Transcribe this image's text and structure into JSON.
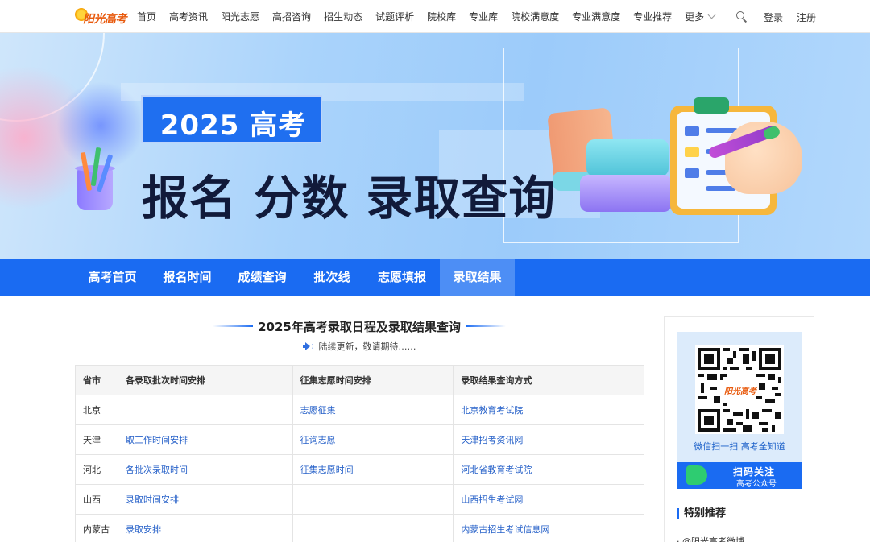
{
  "logo": {
    "text": "阳光高考"
  },
  "nav": {
    "items": [
      "首页",
      "高考资讯",
      "阳光志愿",
      "高招咨询",
      "招生动态",
      "试题评析",
      "院校库",
      "专业库",
      "院校满意度",
      "专业满意度",
      "专业推荐"
    ],
    "more": "更多",
    "login": "登录",
    "register": "注册"
  },
  "banner": {
    "year": "2025 高考",
    "headline": "报名 分数 录取查询"
  },
  "tabs": [
    "高考首页",
    "报名时间",
    "成绩查询",
    "批次线",
    "志愿填报",
    "录取结果"
  ],
  "main": {
    "title": "2025年高考录取日程及录取结果查询",
    "notice": "陆续更新，敬请期待……",
    "table": {
      "headers": [
        "省市",
        "各录取批次时间安排",
        "征集志愿时间安排",
        "录取结果查询方式"
      ],
      "rows": [
        [
          "北京",
          "",
          "志愿征集",
          "北京教育考试院"
        ],
        [
          "天津",
          "取工作时间安排",
          "征询志愿",
          "天津招考资讯网"
        ],
        [
          "河北",
          "各批次录取时间",
          "征集志愿时间",
          "河北省教育考试院"
        ],
        [
          "山西",
          "录取时间安排",
          "",
          "山西招生考试网"
        ],
        [
          "内蒙古",
          "录取安排",
          "",
          "内蒙古招生考试信息网"
        ]
      ]
    }
  },
  "sidebar": {
    "qr_caption": "微信扫一扫 高考全知道",
    "qr_logo": "阳光高考",
    "follow_line1": "扫码关注",
    "follow_line2": "高考公众号",
    "recommend_title": "特别推荐",
    "recommend_item": "· @阳光高考微博"
  },
  "colors": {
    "primary": "#1a6bf2",
    "link": "#2862c9",
    "tab_active": "#4d8ef5"
  }
}
